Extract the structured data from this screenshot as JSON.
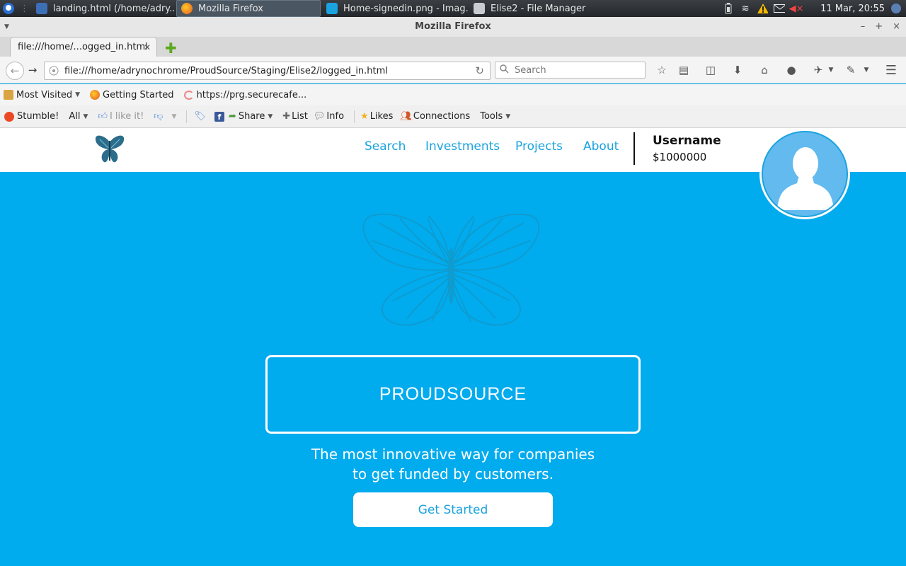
{
  "taskbar": {
    "tasks": [
      {
        "label": "landing.html (/home/adry..."
      },
      {
        "label": "Mozilla Firefox"
      },
      {
        "label": "Home-signedin.png - Imag..."
      },
      {
        "label": "Elise2 - File Manager"
      }
    ],
    "clock": "11 Mar, 20:55"
  },
  "window": {
    "title": "Mozilla Firefox"
  },
  "tab": {
    "title": "file:///home/...ogged_in.html"
  },
  "navbar": {
    "url": "file:///home/adrynochrome/ProudSource/Staging/Elise2/logged_in.html",
    "search_placeholder": "Search"
  },
  "bookmarks": {
    "items": [
      {
        "label": "Most Visited"
      },
      {
        "label": "Getting Started"
      },
      {
        "label": "https://prg.securecafe..."
      }
    ]
  },
  "stumble": {
    "stumble": "Stumble!",
    "all": "All",
    "like": "I like it!",
    "share": "Share",
    "list": "List",
    "info": "Info",
    "likes": "Likes",
    "connections": "Connections",
    "tools": "Tools"
  },
  "site": {
    "nav": [
      {
        "label": "Search"
      },
      {
        "label": "Investments"
      },
      {
        "label": "Projects"
      },
      {
        "label": "About"
      }
    ],
    "username": "Username",
    "balance": "$1000000",
    "brand": "PROUDSOURCE",
    "tagline_line1": "The most innovative way for companies",
    "tagline_line2": "to get funded by customers.",
    "cta": "Get Started"
  },
  "colors": {
    "accent": "#00abee",
    "link": "#1aa3de"
  }
}
